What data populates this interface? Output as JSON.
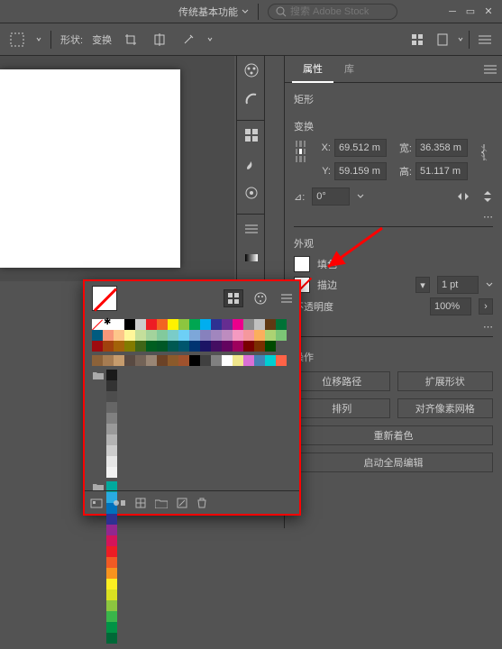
{
  "topbar": {
    "workspace_label": "传统基本功能",
    "search_placeholder": "搜索 Adobe Stock"
  },
  "optionsbar": {
    "shape_label": "形状:",
    "shape_value": "变换"
  },
  "panel": {
    "tabs": {
      "properties": "属性",
      "library": "库"
    },
    "shape_type": "矩形",
    "transform_label": "变换",
    "x_label": "X:",
    "y_label": "Y:",
    "w_label": "宽:",
    "h_label": "高:",
    "x": "69.512 m",
    "y": "59.159 m",
    "w": "36.358 m",
    "h": "51.117 m",
    "rot_label": "⊿:",
    "rot_value": "0°",
    "appearance_label": "外观",
    "fill_label": "填色",
    "stroke_label": "描边",
    "stroke_value": "1 pt",
    "opacity_label": "不透明度",
    "opacity_value": "100%",
    "quick_label": "操作",
    "btn_offset": "位移路径",
    "btn_expand": "扩展形状",
    "btn_arrange": "排列",
    "btn_pixelgrid": "对齐像素网格",
    "btn_recolor": "重新着色",
    "btn_global_edit": "启动全局编辑"
  },
  "swatch_rows": [
    [
      "#ffffff",
      "#000000",
      "#cccccc",
      "#ed1c24",
      "#f26522",
      "#fff200",
      "#8dc63f",
      "#00a651",
      "#00aeef",
      "#2e3192",
      "#662d91",
      "#ec008c",
      "#898989",
      "#c0c0c0",
      "#603913",
      "#007236",
      "#005b7f"
    ],
    [
      "#f7977a",
      "#fdc68a",
      "#fff79a",
      "#c4df9b",
      "#a3d39c",
      "#82ca9c",
      "#7accc8",
      "#6dcff6",
      "#7da7d9",
      "#8781bd",
      "#a186be",
      "#bd8cbf",
      "#f49ac1",
      "#f5989d",
      "#fbaf5d",
      "#acd373",
      "#7cc576"
    ],
    [
      "#9e0b0f",
      "#a0410d",
      "#a36209",
      "#827b00",
      "#406618",
      "#005e20",
      "#005826",
      "#005952",
      "#00566e",
      "#003471",
      "#1b1464",
      "#440e62",
      "#630460",
      "#9e005d",
      "#790000",
      "#7b2e00",
      "#004a00"
    ]
  ],
  "pattern_row": [
    "#8c6239",
    "#a67c52",
    "#c69c6d",
    "#594a42",
    "#736357",
    "#998675",
    "#6b4226",
    "#8b5a2b",
    "#a0522d",
    "#000000",
    "#404040",
    "#808080",
    "#ffffff",
    "#f0e68c",
    "#da70d6",
    "#4682b4",
    "#00ced1",
    "#ff6347"
  ],
  "gray_row": [
    "#1a1a1a",
    "#333333",
    "#4d4d4d",
    "#666666",
    "#808080",
    "#999999",
    "#b3b3b3",
    "#cccccc",
    "#e6e6e6",
    "#f2f2f2"
  ],
  "bright_row": [
    "#00a99d",
    "#29abe2",
    "#0071bc",
    "#2e3192",
    "#93278f",
    "#d4145a",
    "#ed1c24",
    "#f15a24",
    "#f7931e",
    "#fcee21",
    "#d9e021",
    "#8cc63f",
    "#39b54a",
    "#009245",
    "#006837"
  ]
}
